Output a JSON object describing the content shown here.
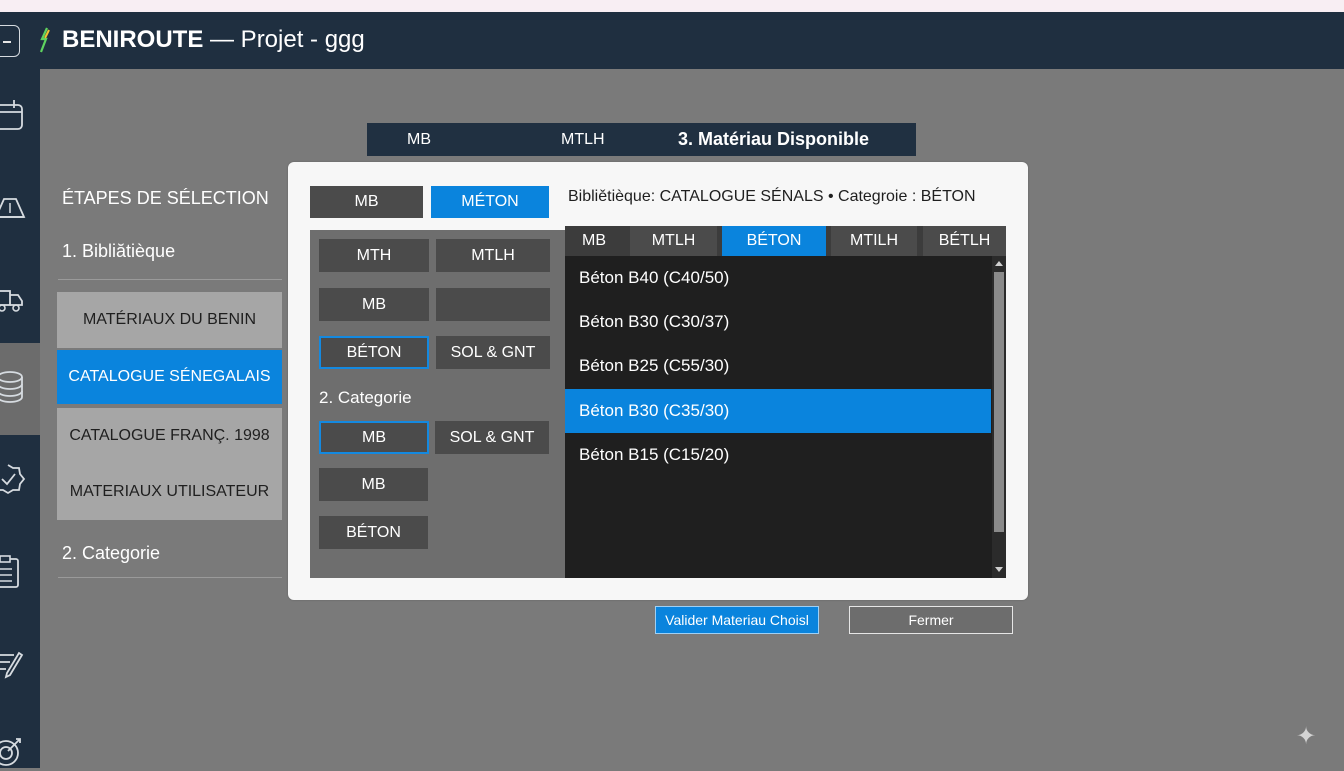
{
  "app": {
    "title_bold": "BENIROUTE",
    "title_rest": " — Projet - ggg"
  },
  "sidebar_icons": [
    "calendar-icon",
    "ruler-icon",
    "truck-icon",
    "database-icon",
    "badge-check-icon",
    "clipboard-icon",
    "pen-icon",
    "target-icon"
  ],
  "steps": {
    "title": "ÉTAPES DE SÉLECTION",
    "step1": "1. Bibliătièque",
    "libraries": [
      {
        "label": "MATÉRIAUX DU BENIN",
        "active": false
      },
      {
        "label": "CATALOGUE SÉNEGALAIS",
        "active": true
      },
      {
        "label": "CATALOGUE FRANÇ. 1998",
        "active": false
      },
      {
        "label": "MATERIAUX UTILISATEUR",
        "active": false
      }
    ],
    "step2": "2. Categorie"
  },
  "top_tabs": {
    "tab1": "MB",
    "tab2": "MTLH",
    "tab3": "3. Matériau Disponible"
  },
  "dialog": {
    "top_buttons": {
      "mb": "MB",
      "meton": "MÉTON"
    },
    "grid": {
      "r1a": "MTH",
      "r1b": "MTLH",
      "r2a": "MB",
      "r2b": "",
      "r3a": "BÉTON",
      "r3b": "SOL & GNT"
    },
    "category_label": "2. Categorie",
    "cat": {
      "c1a": "MB",
      "c1b": "SOL & GNT",
      "c2": "MB",
      "c3": "BÉTON"
    },
    "info": "Bibliětièque: CATALOGUE SÉNALS • Categroie : BÉTON",
    "material_tabs": [
      {
        "label": "MB",
        "active": false
      },
      {
        "label": "MTLH",
        "active": false
      },
      {
        "label": "BÉTON",
        "active": true
      },
      {
        "label": "MTILH",
        "active": false
      },
      {
        "label": "BÉTLH",
        "active": false
      }
    ],
    "materials": [
      {
        "label": "Béton B40 (C40/50)",
        "selected": false
      },
      {
        "label": "Béton B30 (C30/37)",
        "selected": false
      },
      {
        "label": "Béton B25 (C55/30)",
        "selected": false
      },
      {
        "label": "Béton B30 (C35/30)",
        "selected": true
      },
      {
        "label": "Béton B15 (C15/20)",
        "selected": false
      }
    ]
  },
  "buttons": {
    "validate": "Valider Materiau Choisl",
    "close": "Fermer"
  },
  "colors": {
    "accent": "#0a84dd",
    "navy": "#1f2f40"
  }
}
